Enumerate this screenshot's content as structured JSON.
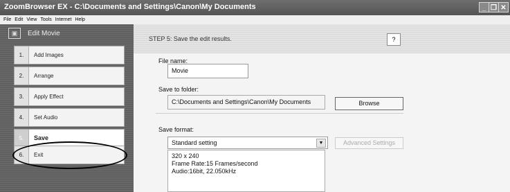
{
  "window": {
    "title": "ZoomBrowser EX  -  C:\\Documents and Settings\\Canon\\My Documents",
    "minimize": "_",
    "restore": "❐",
    "close": "✕"
  },
  "menu": [
    "File",
    "Edit",
    "View",
    "Tools",
    "Internet",
    "Help"
  ],
  "sidebar": {
    "title": "Edit Movie",
    "steps": [
      {
        "num": "1.",
        "label": "Add Images"
      },
      {
        "num": "2.",
        "label": "Arrange"
      },
      {
        "num": "3.",
        "label": "Apply Effect"
      },
      {
        "num": "4.",
        "label": "Set Audio"
      },
      {
        "num": "5.",
        "label": "Save"
      },
      {
        "num": "6.",
        "label": "Exit"
      }
    ]
  },
  "main": {
    "step_title": "STEP 5: Save the edit results.",
    "help": "?",
    "file_name_label": "File name:",
    "file_name_value": "Movie",
    "save_folder_label": "Save to folder:",
    "save_folder_value": "C:\\Documents and Settings\\Canon\\My Documents",
    "browse": "Browse",
    "save_format_label": "Save format:",
    "save_format_value": "Standard setting",
    "advanced": "Advanced Settings",
    "info_lines": [
      "320 x 240",
      "Frame Rate:15 Frames/second",
      "Audio:16bit, 22.050kHz"
    ]
  }
}
